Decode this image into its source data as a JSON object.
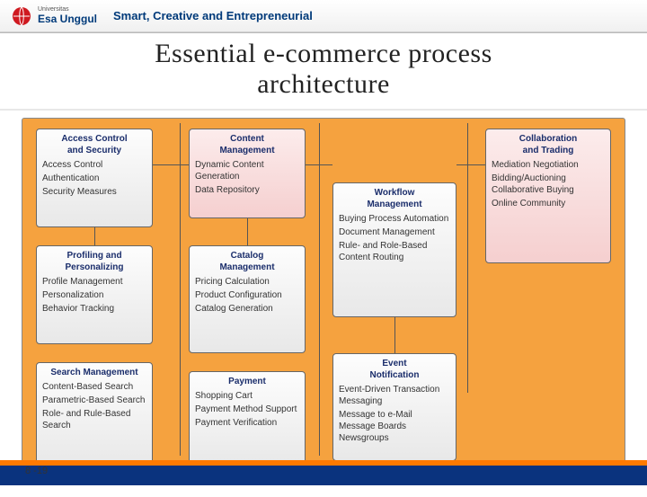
{
  "header": {
    "brand_top": "Universitas",
    "brand": "Esa Unggul",
    "tagline": "Smart, Creative and Entrepreneurial"
  },
  "title": {
    "line1": "Essential e-commerce process",
    "line2": "architecture"
  },
  "columns": {
    "c1": {
      "b1": {
        "title_l1": "Access Control",
        "title_l2": "and Security",
        "i1": "Access Control",
        "i2": "Authentication",
        "i3": "Security Measures"
      },
      "b2": {
        "title_l1": "Profiling and",
        "title_l2": "Personalizing",
        "i1": "Profile Management",
        "i2": "Personalization",
        "i3": "Behavior Tracking"
      },
      "b3": {
        "title": "Search Management",
        "i1": "Content-Based Search",
        "i2": "Parametric-Based Search",
        "i3": "Role- and Rule-Based Search"
      }
    },
    "c2": {
      "b1": {
        "title_l1": "Content",
        "title_l2": "Management",
        "i1": "Dynamic Content Generation",
        "i2": "Data Repository"
      },
      "b2": {
        "title_l1": "Catalog",
        "title_l2": "Management",
        "i1": "Pricing Calculation",
        "i2": "Product Configuration",
        "i3": "Catalog Generation"
      },
      "b3": {
        "title": "Payment",
        "i1": "Shopping Cart",
        "i2": "Payment Method Support",
        "i3": "Payment Verification"
      }
    },
    "c3": {
      "b1": {
        "title_l1": "Workflow",
        "title_l2": "Management",
        "i1": "Buying Process Automation",
        "i2": "Document Management",
        "i3": "Rule- and Role-Based Content Routing"
      },
      "b2": {
        "title_l1": "Event",
        "title_l2": "Notification",
        "i1": "Event-Driven Transaction Messaging",
        "i2": "Message to e-Mail Message Boards Newsgroups"
      }
    },
    "c4": {
      "b1": {
        "title_l1": "Collaboration",
        "title_l2": "and Trading",
        "i1": "Mediation Negotiation",
        "i2": "Bidding/Auctioning Collaborative Buying",
        "i3": "Online Community"
      }
    }
  },
  "footer": {
    "page": "8 -19"
  }
}
